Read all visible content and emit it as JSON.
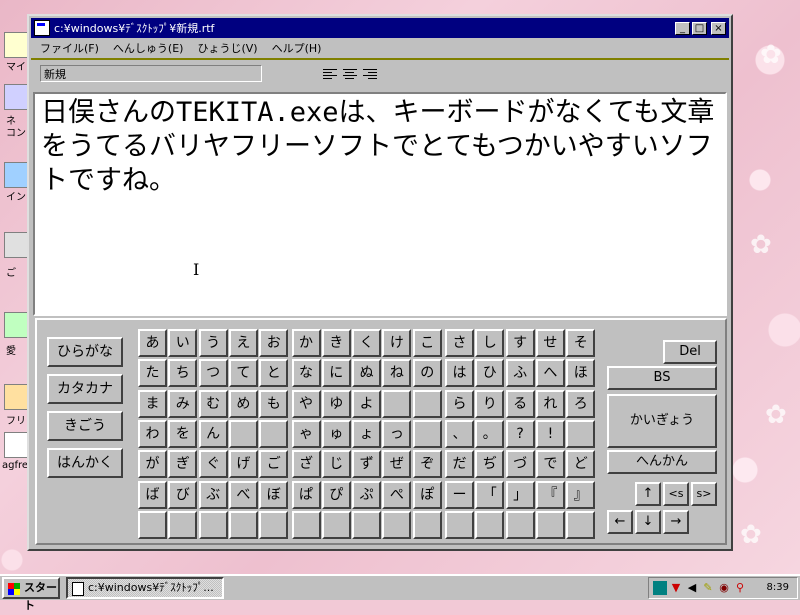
{
  "desktop": {
    "icon_labels": [
      "マイ",
      "ネ",
      "コン",
      "イン",
      "ご",
      "愛",
      "フリ",
      "agfre"
    ]
  },
  "window": {
    "title": "c:¥windows¥ﾃﾞｽｸﾄｯﾌﾟ¥新規.rtf",
    "minimize_label": "_",
    "maximize_label": "□",
    "close_label": "×",
    "menu": [
      "ファイル(F)",
      "へんしゅう(E)",
      "ひょうじ(V)",
      "ヘルプ(H)"
    ],
    "style_value": "新規",
    "document_text": "日俣さんのTEKITA.exeは、キーボードがなくても文章をうてるバリヤフリーソフトでとてもつかいやすいソフトですね。"
  },
  "keyboard": {
    "modes": [
      "ひらがな",
      "カタカナ",
      "きごう",
      "はんかく"
    ],
    "rows": [
      [
        "あ",
        "い",
        "う",
        "え",
        "お",
        "か",
        "き",
        "く",
        "け",
        "こ",
        "さ",
        "し",
        "す",
        "せ",
        "そ"
      ],
      [
        "た",
        "ち",
        "つ",
        "て",
        "と",
        "な",
        "に",
        "ぬ",
        "ね",
        "の",
        "は",
        "ひ",
        "ふ",
        "へ",
        "ほ"
      ],
      [
        "ま",
        "み",
        "む",
        "め",
        "も",
        "や",
        "ゆ",
        "よ",
        "",
        "",
        "ら",
        "り",
        "る",
        "れ",
        "ろ"
      ],
      [
        "わ",
        "を",
        "ん",
        "",
        "",
        "ゃ",
        "ゅ",
        "ょ",
        "っ",
        "",
        "、",
        "。",
        "?",
        "!",
        ""
      ],
      [
        "が",
        "ぎ",
        "ぐ",
        "げ",
        "ご",
        "ざ",
        "じ",
        "ず",
        "ぜ",
        "ぞ",
        "だ",
        "ぢ",
        "づ",
        "で",
        "ど"
      ],
      [
        "ば",
        "び",
        "ぶ",
        "べ",
        "ぼ",
        "ぱ",
        "ぴ",
        "ぷ",
        "ぺ",
        "ぽ",
        "ー",
        "「",
        "」",
        "『",
        "』"
      ],
      [
        "",
        "",
        "",
        "",
        "",
        "",
        "",
        "",
        "",
        "",
        "",
        "",
        "",
        "",
        ""
      ]
    ],
    "del_label": "Del",
    "bs_label": "BS",
    "newline_label": "かいぎょう",
    "convert_label": "へんかん",
    "up_label": "↑",
    "left_s_label": "<s",
    "right_s_label": "s>",
    "left_label": "←",
    "down_label": "↓",
    "right_label": "→"
  },
  "taskbar": {
    "start_label": "スタート",
    "task_label": "c:¥windows¥ﾃﾞｽｸﾄｯﾌﾟ...",
    "clock": "8:39"
  }
}
